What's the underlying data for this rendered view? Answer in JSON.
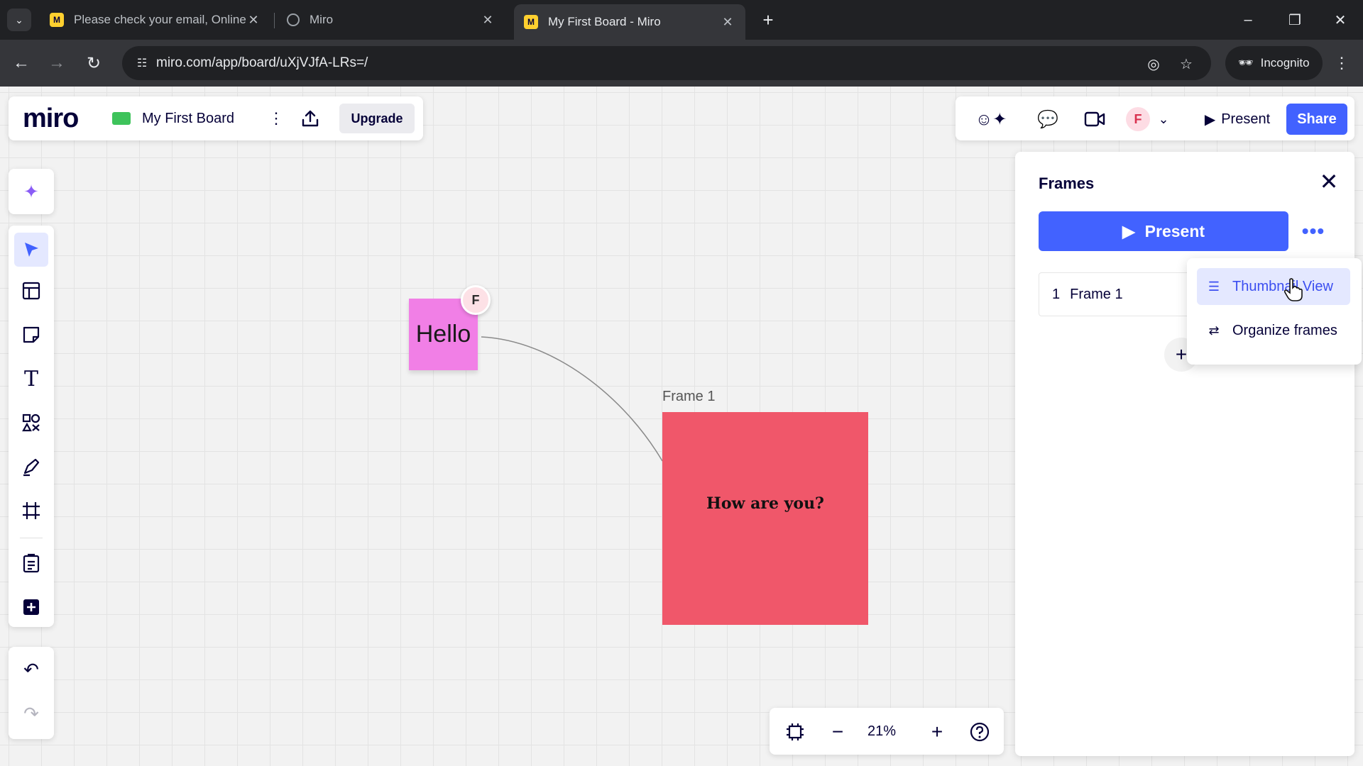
{
  "browser": {
    "tabs": [
      {
        "title": "Please check your email, Online",
        "favicon": "miro-favicon"
      },
      {
        "title": "Miro",
        "favicon": "globe-icon"
      },
      {
        "title": "My First Board - Miro",
        "favicon": "miro-favicon",
        "active": true
      }
    ],
    "url": "miro.com/app/board/uXjVJfA-LRs=/",
    "incognito_label": "Incognito"
  },
  "board": {
    "logo": "miro",
    "name": "My First Board",
    "upgrade_label": "Upgrade",
    "present_label": "Present",
    "share_label": "Share",
    "avatar_initial": "F",
    "accent_color": "#4262ff"
  },
  "canvas": {
    "sticky_text": "Hello",
    "sticky_color": "#f17fe6",
    "cursor_initial": "F",
    "frame_label": "Frame 1",
    "frame_text": "How are you?",
    "frame_color": "#f0576a"
  },
  "zoom": {
    "value": "21%"
  },
  "frames_panel": {
    "title": "Frames",
    "present_label": "Present",
    "frames": [
      {
        "number": "1",
        "name": "Frame 1"
      }
    ],
    "menu": [
      {
        "label": "Thumbnail View",
        "icon": "thumbnail-view-icon"
      },
      {
        "label": "Organize frames",
        "icon": "organize-frames-icon"
      }
    ]
  }
}
